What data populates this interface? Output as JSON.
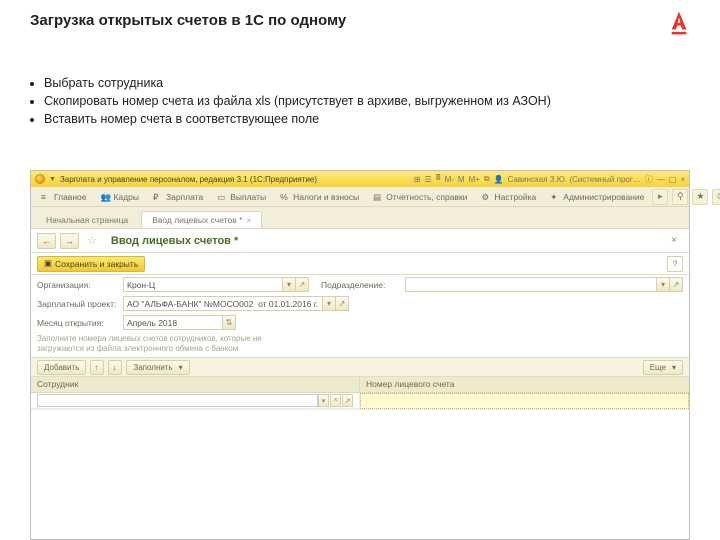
{
  "slide": {
    "title": "Загрузка открытых счетов в 1С по одному",
    "bullets": [
      "Выбрать сотрудника",
      "Скопировать номер счета из файла xls (присутствует в архиве, выгруженном из АЗОН)",
      "Вставить номер счета в соответствующее поле"
    ]
  },
  "window": {
    "title": "Зарплата и управление персоналом, редакция 3.1  (1С:Предприятие)",
    "user_text": "Савинская З.Ю. (Системный прог…",
    "m_labels": [
      "M",
      "M+",
      "M-"
    ]
  },
  "menu": {
    "items": [
      "Главное",
      "Кадры",
      "Зарплата",
      "Выплаты",
      "Налоги и взносы",
      "Отчетность, справки",
      "Настройка",
      "Администрирование"
    ]
  },
  "tabs": {
    "items": [
      {
        "label": "Начальная страница",
        "active": false
      },
      {
        "label": "Ввод лицевых счетов *",
        "active": true
      }
    ]
  },
  "toolbar": {
    "back": "←",
    "fwd": "→",
    "form_title": "Ввод лицевых счетов *",
    "close": "×"
  },
  "actionbar": {
    "save": "Сохранить и закрыть",
    "help": "?"
  },
  "form": {
    "org_label": "Организация:",
    "org_value": "Крон-Ц",
    "dept_label": "Подразделение:",
    "dept_value": "",
    "proj_label": "Зарплатный проект:",
    "proj_value": "АО \"АЛЬФА-БАНК\" №МОСО002  от 01.01.2016 г.",
    "month_label": "Месяц открытия:",
    "month_value": "Апрель 2018",
    "hint_l1": "Заполните номера лицевых счетов сотрудников, которые не",
    "hint_l2": "загружаются из файла электронного обмена с банком"
  },
  "listtools": {
    "add": "Добавить",
    "up": "↑",
    "down": "↓",
    "fill": "Заполнить",
    "more": "Еще"
  },
  "grid": {
    "col1": "Сотрудник",
    "col2": "Номер лицевого счета"
  },
  "icons": {
    "dropdown": "▾",
    "open": "⋯",
    "link": "↗",
    "clear": "×"
  }
}
